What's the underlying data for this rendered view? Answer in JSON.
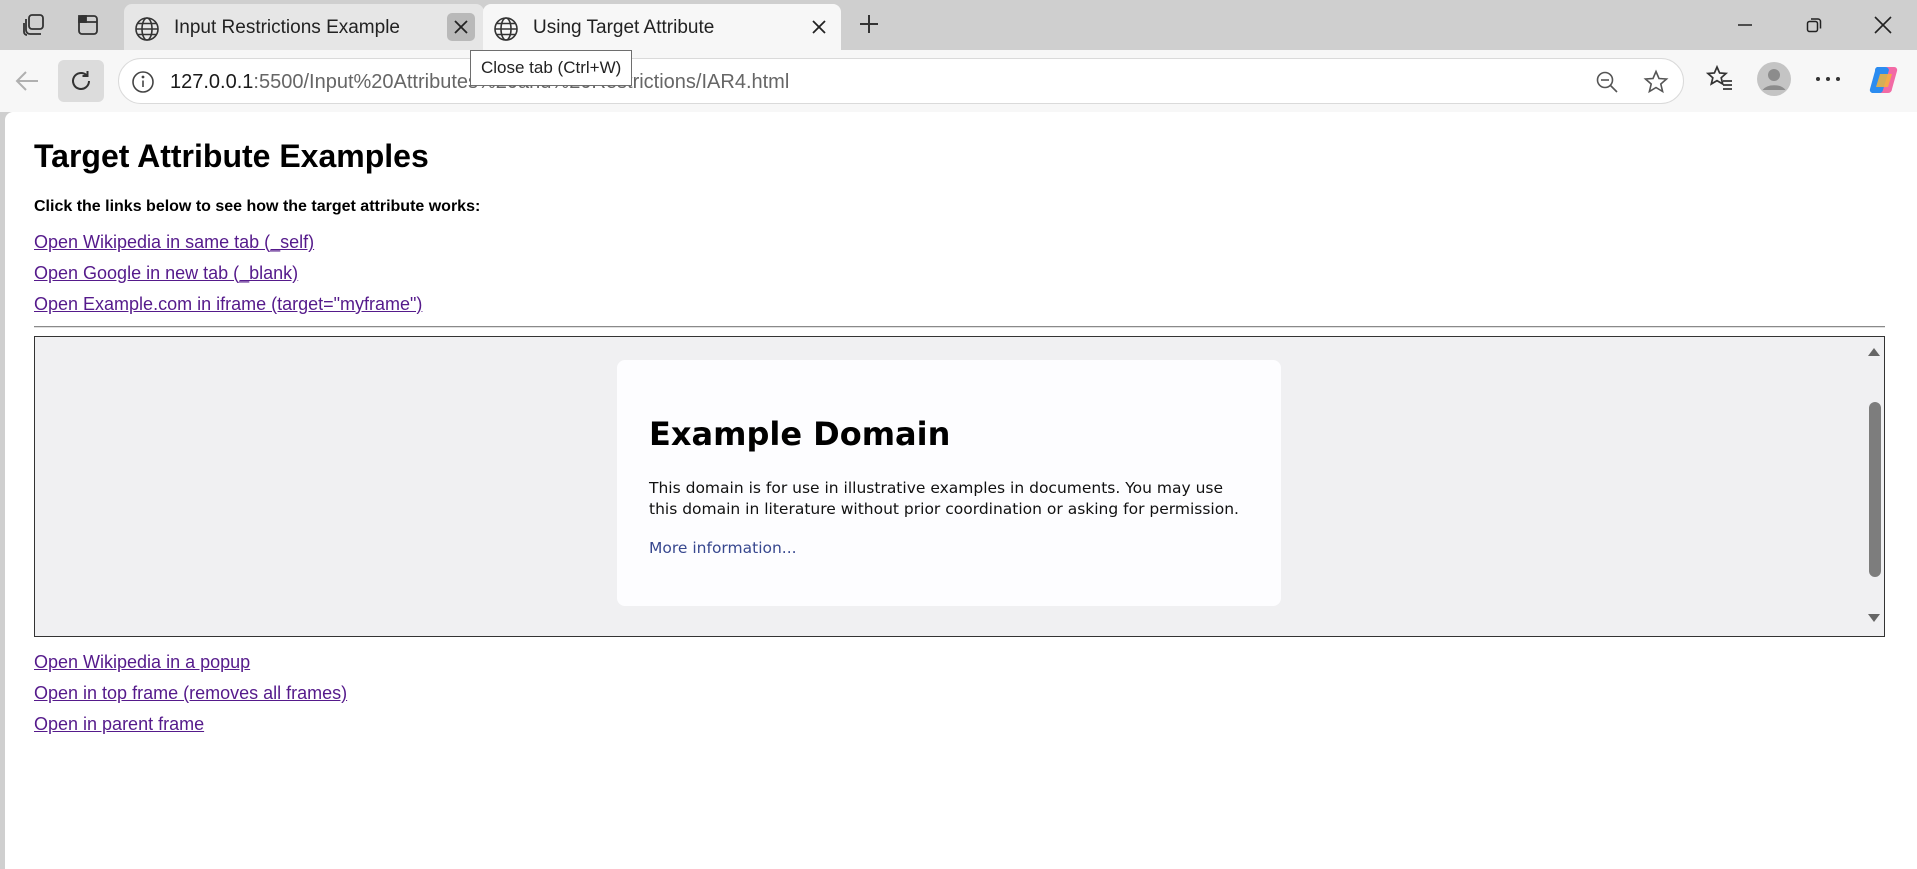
{
  "browser": {
    "tabs": [
      {
        "title": "Input Restrictions Example",
        "active": false
      },
      {
        "title": "Using Target Attribute",
        "active": true
      }
    ],
    "tooltip": "Close tab (Ctrl+W)",
    "address": {
      "host": "127.0.0.1",
      "rest": ":5500/Input%20Attributes%20and%20Restrictions/IAR4.html"
    },
    "icons": {
      "workspaces": "workspaces-icon",
      "tab_actions": "tab-actions-icon",
      "globe": "globe-icon",
      "close": "close-icon",
      "new_tab": "plus-icon",
      "minimize": "minimize-icon",
      "restore": "restore-icon",
      "back": "back-arrow-icon",
      "reload": "reload-icon",
      "site_info": "info-icon",
      "zoom": "zoom-out-icon",
      "favorite": "star-icon",
      "favorites": "favorites-icon",
      "profile": "profile-icon",
      "menu": "more-icon",
      "copilot": "copilot-icon"
    }
  },
  "page": {
    "heading": "Target Attribute Examples",
    "intro": "Click the links below to see how the target attribute works:",
    "links_top": [
      "Open Wikipedia in same tab (_self)",
      "Open Google in new tab (_blank)",
      "Open Example.com in iframe (target=\"myframe\")"
    ],
    "iframe": {
      "title": "Example Domain",
      "text": "This domain is for use in illustrative examples in documents. You may use this domain in literature without prior coordination or asking for permission.",
      "link": "More information..."
    },
    "links_bottom": [
      "Open Wikipedia in a popup",
      "Open in top frame (removes all frames)",
      "Open in parent frame"
    ],
    "colors": {
      "visited_link": "#551a8b",
      "iframe_background": "#f0f0f2",
      "iframe_link": "#38488f"
    }
  }
}
